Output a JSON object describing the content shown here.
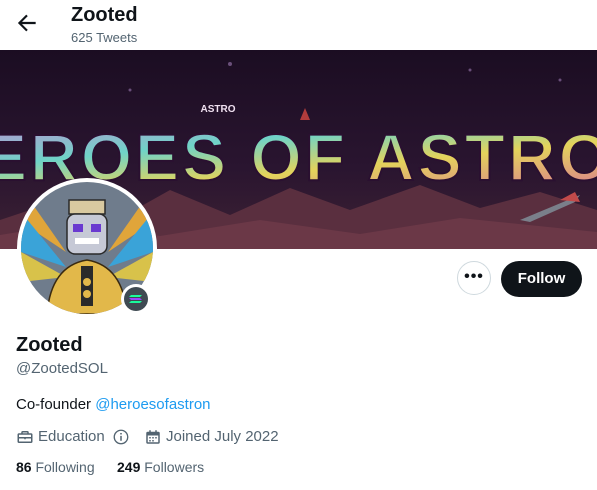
{
  "header": {
    "title": "Zooted",
    "tweet_count": "625 Tweets"
  },
  "banner": {
    "text": "HEROES OF ASTRON",
    "small_text": "ASTRO"
  },
  "actions": {
    "follow_label": "Follow",
    "more_label": "•••"
  },
  "profile": {
    "name": "Zooted",
    "handle": "@ZootedSOL",
    "bio_prefix": "Co-founder ",
    "bio_mention": "@heroesofastron",
    "category": "Education",
    "joined": "Joined July 2022",
    "following_count": "86",
    "following_label": "Following",
    "followers_count": "249",
    "followers_label": "Followers"
  },
  "icons": {
    "back": "arrow-left-icon",
    "briefcase": "briefcase-icon",
    "info": "info-icon",
    "calendar": "calendar-icon",
    "solana": "solana-badge-icon"
  },
  "colors": {
    "accent": "#1d9bf0",
    "follow_bg": "#0f1419",
    "muted": "#536471"
  }
}
